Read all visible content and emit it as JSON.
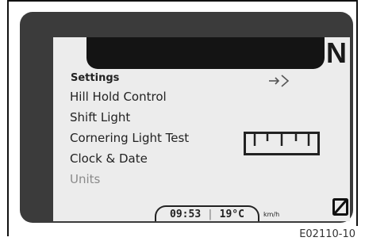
{
  "gear_indicator": "N",
  "menu": {
    "title": "Settings",
    "items": [
      {
        "label": "Hill Hold Control",
        "dimmed": false
      },
      {
        "label": "Shift Light",
        "dimmed": false
      },
      {
        "label": "Cornering Light Test",
        "dimmed": false
      },
      {
        "label": "Clock & Date",
        "dimmed": false
      },
      {
        "label": "Units",
        "dimmed": true
      }
    ]
  },
  "status_bar": {
    "time": "09:53",
    "temperature": "19°C",
    "speed_unit": "km/h"
  },
  "icons": {
    "enter": "arrow-enter-icon",
    "ruler": "ruler-icon",
    "box": "slashed-box-icon"
  },
  "figure_reference": "E02110-10"
}
